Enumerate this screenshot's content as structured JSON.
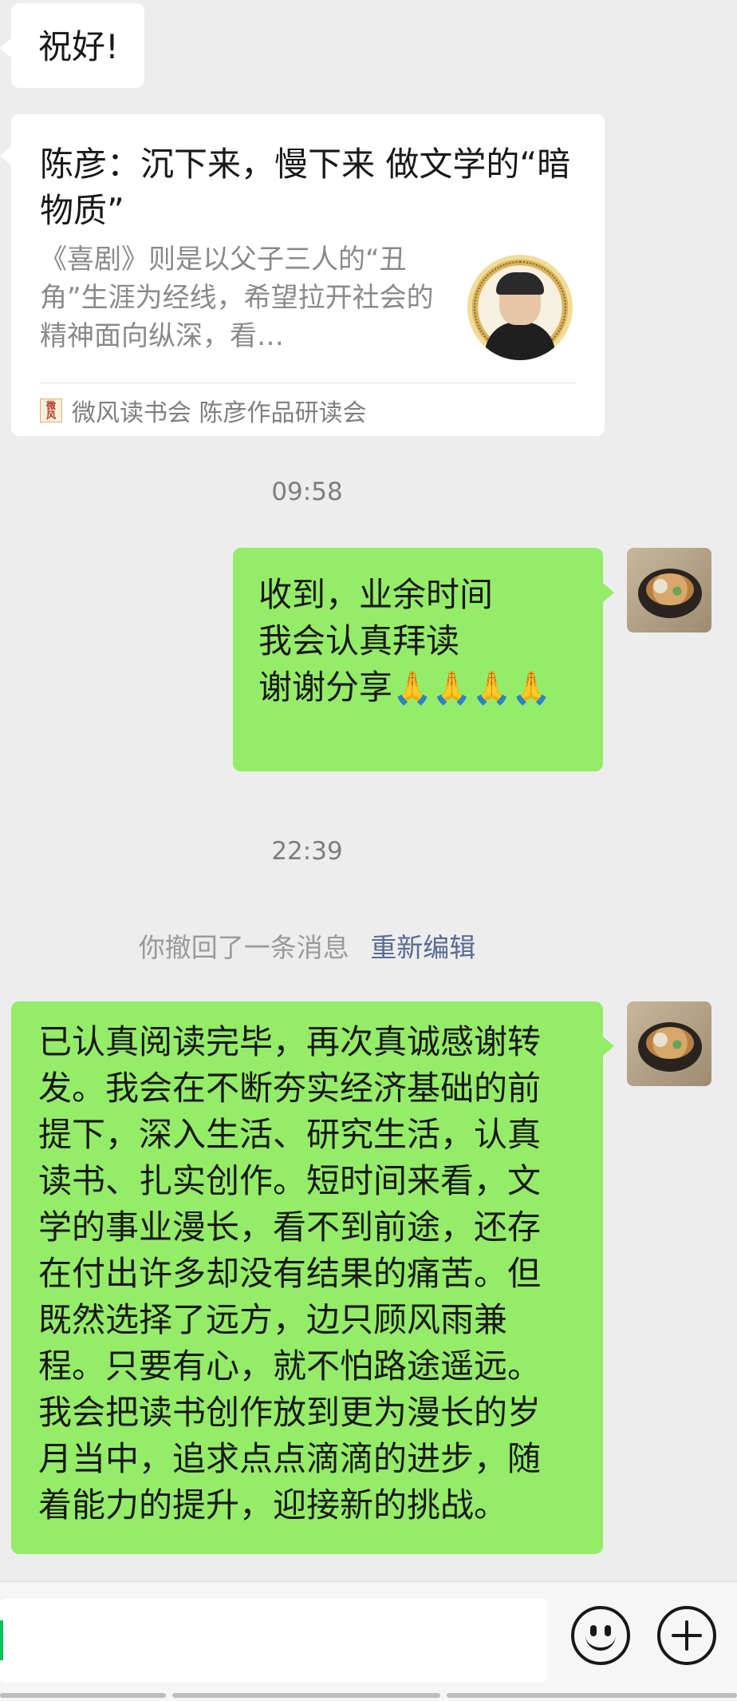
{
  "messages": {
    "greeting": "祝好!",
    "link_card": {
      "title": "陈彦：沉下来，慢下来 做文学的“暗物质”",
      "description": "《喜剧》则是以父子三人的“丑角”生涯为经线，希望拉开社会的精神面向纵深，看…",
      "source": "微风读书会 陈彦作品研读会",
      "thumbnail_icon": "author-portrait-seal"
    },
    "time1": "09:58",
    "reply1": {
      "line1": "收到，业余时间",
      "line2": "我会认真拜读",
      "line3": "",
      "line4": "谢谢分享",
      "emoji": "🙏🙏🙏🙏"
    },
    "time2": "22:39",
    "recall": {
      "text": "你撤回了一条消息",
      "edit": "重新编辑"
    },
    "reply2": {
      "lines": [
        "已认真阅读完毕，再次真诚感谢转",
        "发。我会在不断夯实经济基础的前",
        "提下，深入生活、研究生活，认真",
        "读书、扎实创作。短时间来看，文",
        "学的事业漫长，看不到前途，还存",
        "在付出许多却没有结果的痛苦。但",
        "既然选择了远方，边只顾风雨兼",
        "程。只要有心，就不怕路途遥远。",
        "我会把读书创作放到更为漫长的岁",
        "月当中，追求点点滴滴的进步，随",
        "着能力的提升，迎接新的挑战。"
      ]
    }
  },
  "input_bar": {
    "emoji_icon": "emoji-icon",
    "plus_icon": "plus-icon"
  },
  "colors": {
    "background": "#ededed",
    "self_bubble": "#95ec69",
    "other_bubble": "#ffffff",
    "link": "#576b95"
  }
}
